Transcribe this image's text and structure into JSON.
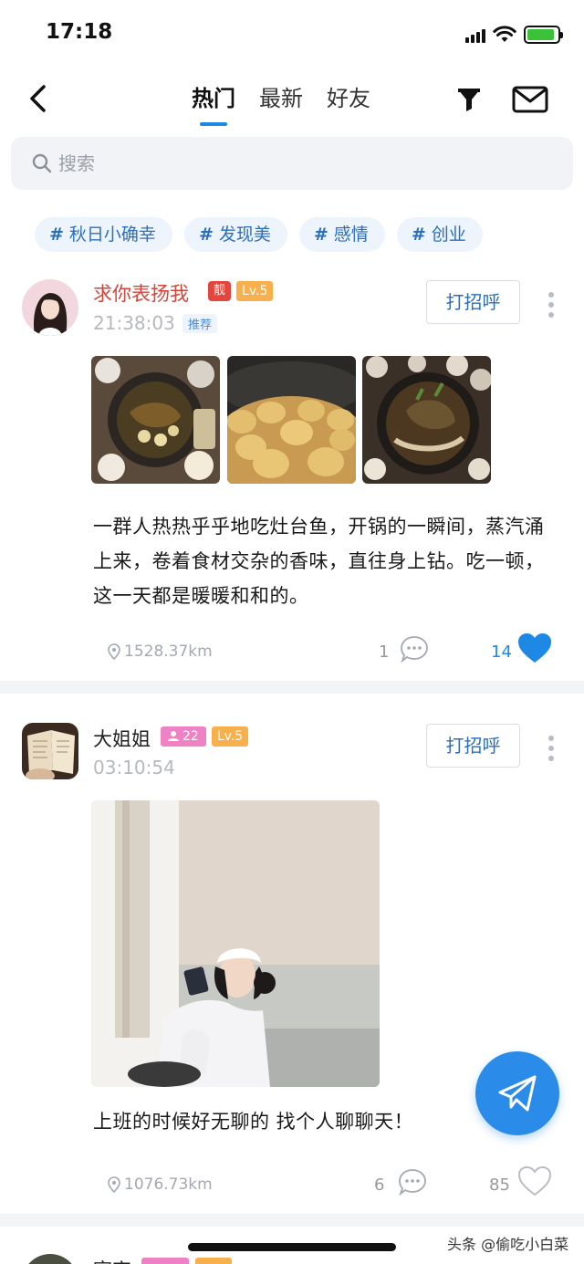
{
  "status_bar": {
    "time": "17:18",
    "battery_level": 0.9,
    "battery_color": "#3cc13b"
  },
  "nav": {
    "tabs": [
      {
        "label": "热门",
        "active": true
      },
      {
        "label": "最新",
        "active": false
      },
      {
        "label": "好友",
        "active": false
      }
    ],
    "icons": {
      "back": "chevron-left-icon",
      "filter": "funnel-icon",
      "messages": "envelope-icon"
    }
  },
  "search": {
    "placeholder": "搜索",
    "value": ""
  },
  "topics": [
    {
      "hash": "#",
      "label": "秋日小确幸"
    },
    {
      "hash": "#",
      "label": "发现美"
    },
    {
      "hash": "#",
      "label": "感情"
    },
    {
      "hash": "#",
      "label": "创业"
    }
  ],
  "posts": [
    {
      "username": "求你表扬我",
      "username_color": "#d2463c",
      "badge_pretty": "靓",
      "level": "Lv.5",
      "time": "21:38:03",
      "tag": "推荐",
      "greet_label": "打招呼",
      "text": "一群人热热乎乎地吃灶台鱼，开锅的一瞬间，蒸汽涌上来，卷着食材交杂的香味，直往身上钻。吃一顿，这一天都是暖暖和和的。",
      "distance": "1528.37km",
      "comments": "1",
      "likes": "14",
      "liked": true
    },
    {
      "username": "大姐姐",
      "username_color": "#222222",
      "gender_age": "22",
      "level": "Lv.5",
      "time": "03:10:54",
      "greet_label": "打招呼",
      "text": "上班的时候好无聊的 找个人聊聊天！",
      "distance": "1076.73km",
      "comments": "6",
      "likes": "85",
      "liked": false
    },
    {
      "username": "寂宇"
    }
  ],
  "colors": {
    "accent": "#1e88e5",
    "like": "#1e88e5",
    "fab": "#2a8ce8"
  },
  "watermark": "头条 @偷吃小白菜"
}
